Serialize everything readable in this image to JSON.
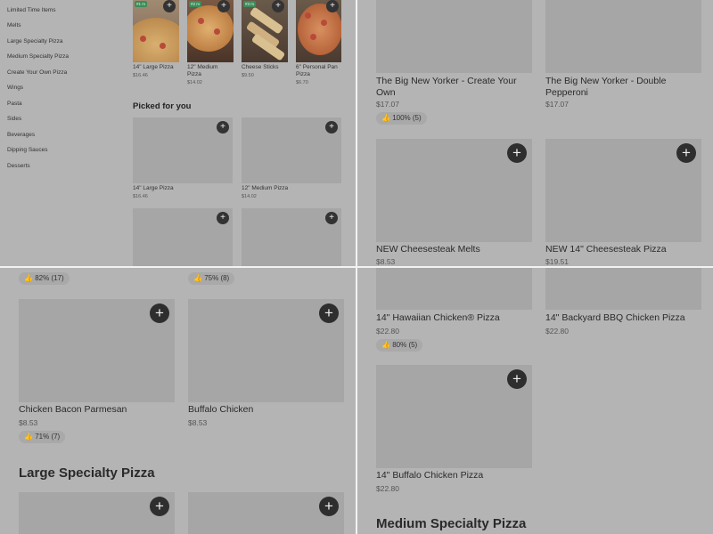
{
  "sidebar": {
    "categories": [
      "Limited Time Items",
      "Melts",
      "Large Specialty Pizza",
      "Medium Specialty Pizza",
      "Create Your Own Pizza",
      "Wings",
      "Pasta",
      "Sides",
      "Beverages",
      "Dipping Sauces",
      "Desserts"
    ]
  },
  "top_items": [
    {
      "badge": "#1 m",
      "name": "14\" Large Pizza",
      "price": "$16.46"
    },
    {
      "badge": "#2 m",
      "name": "12\" Medium Pizza",
      "price": "$14.02"
    },
    {
      "badge": "#3 m",
      "name": "Cheese Sticks",
      "price": "$9.50"
    },
    {
      "badge": "",
      "name": "6\" Personal Pan Pizza",
      "price": "$6.70"
    }
  ],
  "picked_for_you": {
    "title": "Picked for you",
    "items": [
      {
        "name": "14\" Large Pizza",
        "price": "$16.46"
      },
      {
        "name": "12\" Medium Pizza",
        "price": "$14.02"
      }
    ]
  },
  "q2": {
    "items": [
      {
        "name": "The Big New Yorker - Create Your Own",
        "price": "$17.07",
        "rating": "100% (5)"
      },
      {
        "name": "The Big New Yorker - Double Pepperoni",
        "price": "$17.07"
      },
      {
        "name": "NEW Cheesesteak Melts",
        "price": "$8.53"
      },
      {
        "name": "NEW 14\" Cheesesteak Pizza",
        "price": "$19.51"
      }
    ]
  },
  "q3": {
    "ratings_top": [
      "82% (17)",
      "75% (8)"
    ],
    "items": [
      {
        "name": "Chicken Bacon Parmesan",
        "price": "$8.53",
        "rating": "71% (7)"
      },
      {
        "name": "Buffalo Chicken",
        "price": "$8.53"
      }
    ],
    "section": "Large Specialty Pizza"
  },
  "q4": {
    "items": [
      {
        "name": "14\" Hawaiian Chicken® Pizza",
        "price": "$22.80",
        "rating": "80% (5)"
      },
      {
        "name": "14\" Backyard BBQ Chicken Pizza",
        "price": "$22.80"
      },
      {
        "name": "14\" Buffalo Chicken Pizza",
        "price": "$22.80"
      }
    ],
    "section": "Medium Specialty Pizza"
  },
  "icons": {
    "add": "+",
    "thumbs_up": "👍"
  }
}
